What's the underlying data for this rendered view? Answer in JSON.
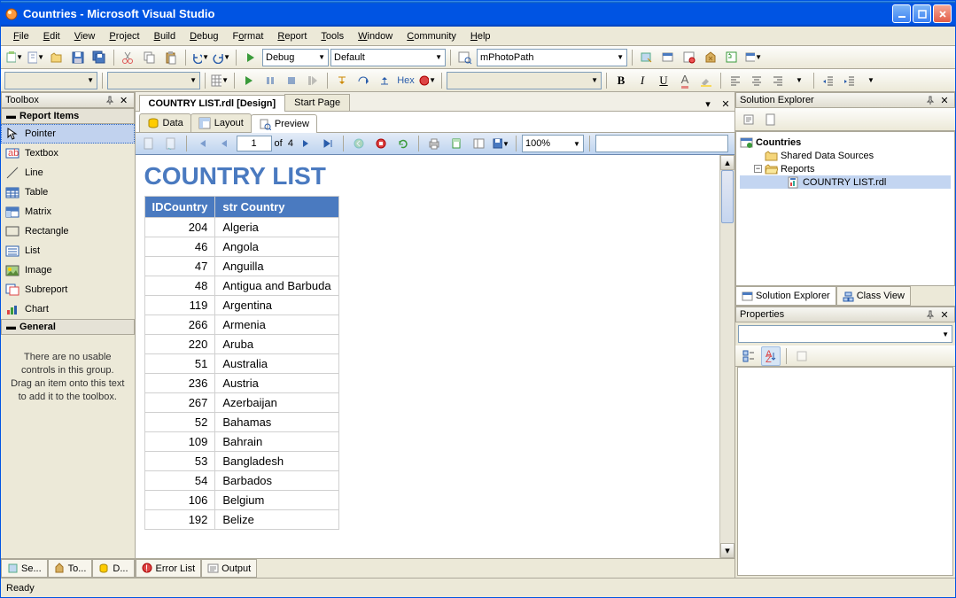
{
  "window": {
    "title": "Countries - Microsoft Visual Studio"
  },
  "menu": [
    "File",
    "Edit",
    "View",
    "Project",
    "Build",
    "Debug",
    "Format",
    "Report",
    "Tools",
    "Window",
    "Community",
    "Help"
  ],
  "toolbar1": {
    "config": "Debug",
    "platform": "Default",
    "find": "mPhotoPath"
  },
  "toolbar2": {
    "hex": "Hex"
  },
  "toolbox": {
    "title": "Toolbox",
    "group1": "Report Items",
    "items": [
      "Pointer",
      "Textbox",
      "Line",
      "Table",
      "Matrix",
      "Rectangle",
      "List",
      "Image",
      "Subreport",
      "Chart"
    ],
    "group2": "General",
    "hint": "There are no usable controls in this group. Drag an item onto this text to add it to the toolbox."
  },
  "tabs": {
    "active": "COUNTRY LIST.rdl [Design]",
    "other": "Start Page"
  },
  "subtabs": {
    "data": "Data",
    "layout": "Layout",
    "preview": "Preview"
  },
  "preview": {
    "page": "1",
    "of": "of  4",
    "zoom": "100%"
  },
  "report": {
    "title": "COUNTRY LIST",
    "col1": "IDCountry",
    "col2": "str Country",
    "rows": [
      {
        "id": "204",
        "name": "Algeria"
      },
      {
        "id": "46",
        "name": "Angola"
      },
      {
        "id": "47",
        "name": "Anguilla"
      },
      {
        "id": "48",
        "name": "Antigua and Barbuda"
      },
      {
        "id": "119",
        "name": "Argentina"
      },
      {
        "id": "266",
        "name": "Armenia"
      },
      {
        "id": "220",
        "name": "Aruba"
      },
      {
        "id": "51",
        "name": "Australia"
      },
      {
        "id": "236",
        "name": "Austria"
      },
      {
        "id": "267",
        "name": "Azerbaijan"
      },
      {
        "id": "52",
        "name": "Bahamas"
      },
      {
        "id": "109",
        "name": "Bahrain"
      },
      {
        "id": "53",
        "name": "Bangladesh"
      },
      {
        "id": "54",
        "name": "Barbados"
      },
      {
        "id": "106",
        "name": "Belgium"
      },
      {
        "id": "192",
        "name": "Belize"
      }
    ]
  },
  "solution": {
    "title": "Solution Explorer",
    "root": "Countries",
    "shared": "Shared Data Sources",
    "reports": "Reports",
    "file": "COUNTRY LIST.rdl"
  },
  "soltabs": {
    "se": "Solution Explorer",
    "cv": "Class View"
  },
  "props": {
    "title": "Properties"
  },
  "btabs": {
    "se": "Se...",
    "to": "To...",
    "d": "D...",
    "el": "Error List",
    "out": "Output"
  },
  "status": "Ready"
}
